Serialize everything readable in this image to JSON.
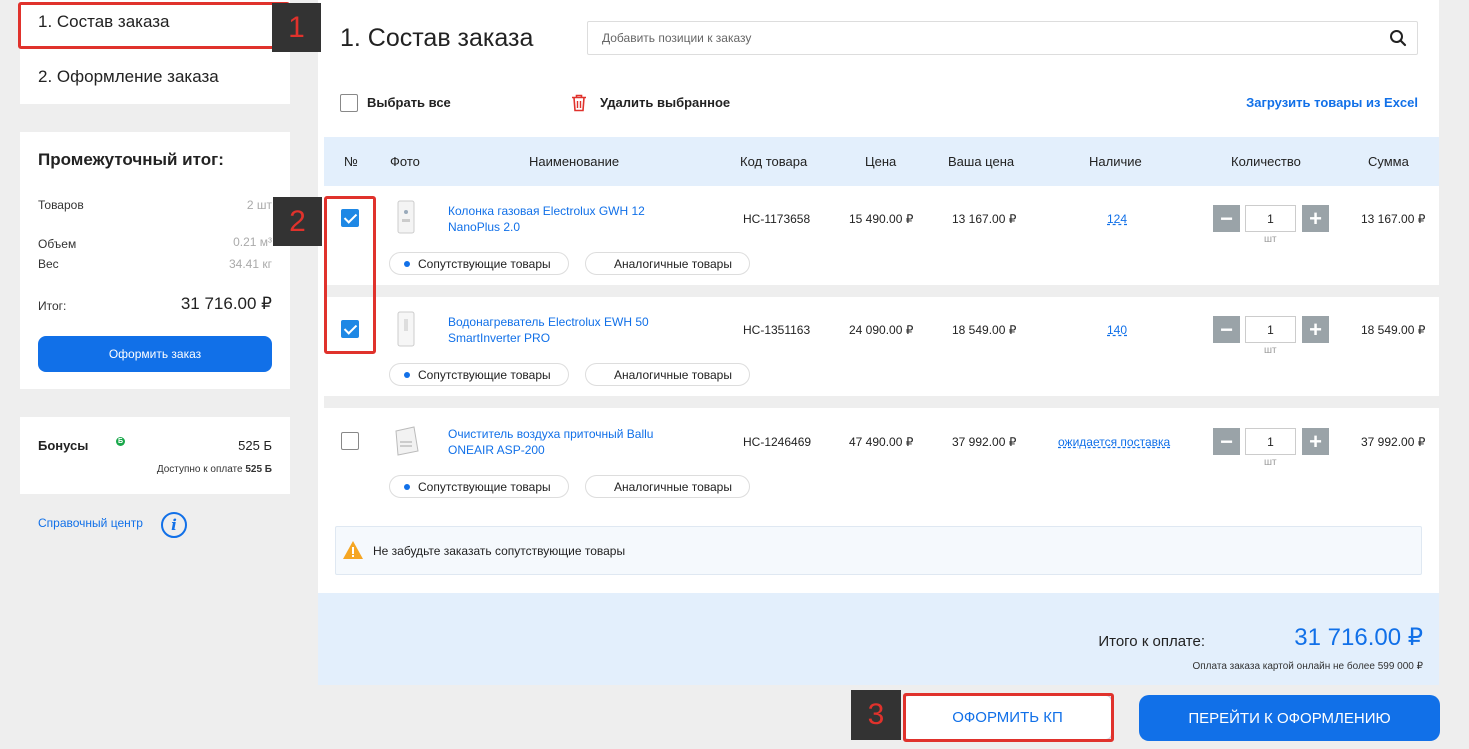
{
  "steps": {
    "step1": "1. Состав заказа",
    "step2": "2. Оформление заказа"
  },
  "summary": {
    "title": "Промежуточный итог:",
    "goods_label": "Товаров",
    "goods_value": "2 шт",
    "volume_label": "Объем",
    "volume_value": "0.21 м³",
    "weight_label": "Вес",
    "weight_value": "34.41 кг",
    "total_label": "Итог:",
    "total_value": "31 716.00 ₽",
    "checkout_button": "Оформить заказ"
  },
  "bonus": {
    "title": "Бонусы",
    "value": "525 Б",
    "available_prefix": "Доступно к оплате ",
    "available_value": "525 Б"
  },
  "help": {
    "label": "Справочный центр"
  },
  "main": {
    "title": "1. Состав заказа",
    "search_placeholder": "Добавить позиции к заказу",
    "select_all": "Выбрать все",
    "delete_selected": "Удалить выбранное",
    "upload_excel": "Загрузить товары из Excel"
  },
  "table": {
    "headers": [
      "№",
      "Фото",
      "Наименование",
      "Код товара",
      "Цена",
      "Ваша цена",
      "Наличие",
      "Количество",
      "Сумма"
    ],
    "rows": [
      {
        "checked": true,
        "name_line1": "Колонка газовая Electrolux GWH 12",
        "name_line2": "NanoPlus 2.0",
        "code": "НС-1173658",
        "price": "15 490.00 ₽",
        "your_price": "13 167.00 ₽",
        "stock": "124",
        "qty": "1",
        "unit": "шт",
        "sum": "13 167.00 ₽",
        "related": "Сопутствующие товары",
        "similar": "Аналогичные товары"
      },
      {
        "checked": true,
        "name_line1": "Водонагреватель Electrolux EWH 50",
        "name_line2": "SmartInverter PRO",
        "code": "НС-1351163",
        "price": "24 090.00 ₽",
        "your_price": "18 549.00 ₽",
        "stock": "140",
        "qty": "1",
        "unit": "шт",
        "sum": "18 549.00 ₽",
        "related": "Сопутствующие товары",
        "similar": "Аналогичные товары"
      },
      {
        "checked": false,
        "name_line1": "Очиститель воздуха приточный Ballu",
        "name_line2": "ONEAIR ASP-200",
        "code": "НС-1246469",
        "price": "47 490.00 ₽",
        "your_price": "37 992.00 ₽",
        "stock": "ожидается поставка",
        "qty": "1",
        "unit": "шт",
        "sum": "37 992.00 ₽",
        "related": "Сопутствующие товары",
        "similar": "Аналогичные товары"
      }
    ]
  },
  "warning": {
    "text": "Не забудьте заказать сопутствующие товары"
  },
  "footer": {
    "total_label": "Итого к оплате:",
    "total_value": "31 716.00 ₽",
    "note": "Оплата заказа картой онлайн не более 599 000 ₽"
  },
  "actions": {
    "kp_button": "ОФОРМИТЬ КП",
    "go_button": "ПЕРЕЙТИ К ОФОРМЛЕНИЮ"
  },
  "annotations": {
    "badge1": "1",
    "badge2": "2",
    "badge3": "3",
    "color": "#e0322c"
  },
  "colors": {
    "accent": "#1170e8",
    "header_bg": "#e3effc",
    "page_bg": "#eeeeee"
  }
}
